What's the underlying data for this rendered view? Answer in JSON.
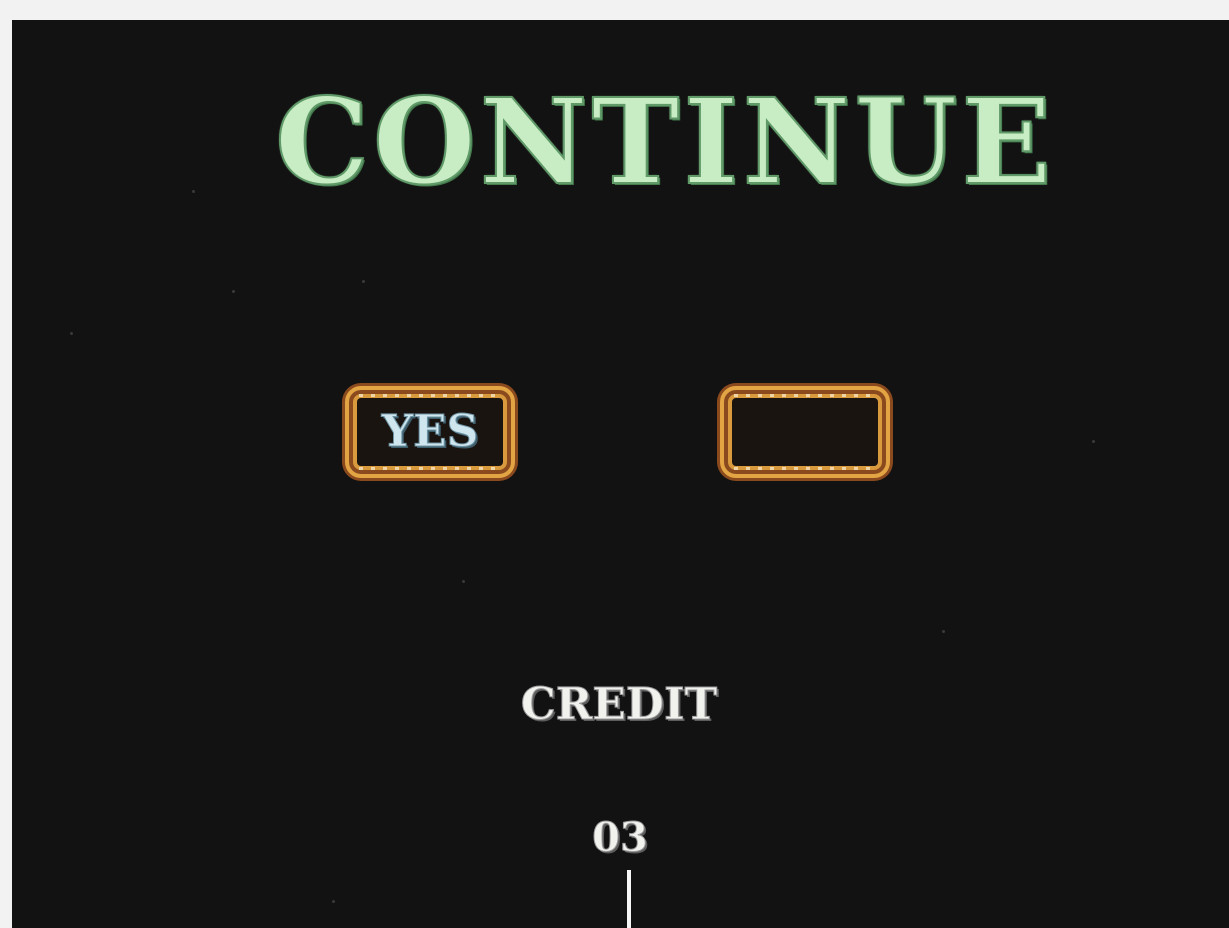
{
  "screen": {
    "title": "CONTINUE",
    "options": [
      {
        "label": "YES",
        "selected": true
      },
      {
        "label": "",
        "selected": false
      }
    ],
    "credit": {
      "label": "CREDIT",
      "count": "03"
    }
  },
  "colors": {
    "background": "#121212",
    "title_green": "#c8ecc4",
    "frame_gold": "#e3a543",
    "option_text": "#cfe6ee",
    "credit_text": "#f1f1ee"
  }
}
